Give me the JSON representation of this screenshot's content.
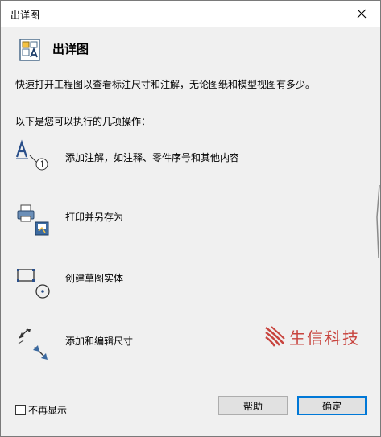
{
  "window": {
    "title": "出详图",
    "close_symbol": "✕"
  },
  "header": {
    "title": "出详图",
    "icon": "detail-drawing-icon"
  },
  "intro_text": "快速打开工程图以查看标注尺寸和注解，无论图纸和模型视图有多少。",
  "operations_label": "以下是您可以执行的几项操作：",
  "operations": [
    {
      "label": "添加注解，如注释、零件序号和其他内容",
      "icon": "annotation-icon"
    },
    {
      "label": "打印并另存为",
      "icon": "print-save-icon"
    },
    {
      "label": "创建草图实体",
      "icon": "sketch-entity-icon"
    },
    {
      "label": "添加和编辑尺寸",
      "icon": "dimension-icon"
    }
  ],
  "watermark": {
    "text": "生信科技"
  },
  "footer": {
    "dont_show_label": "不再显示",
    "dont_show_checked": false,
    "help_label": "帮助",
    "ok_label": "确定"
  },
  "colors": {
    "accent": "#0078d7",
    "dialog_bg": "#f0f0f0",
    "watermark": "#c8443e"
  }
}
